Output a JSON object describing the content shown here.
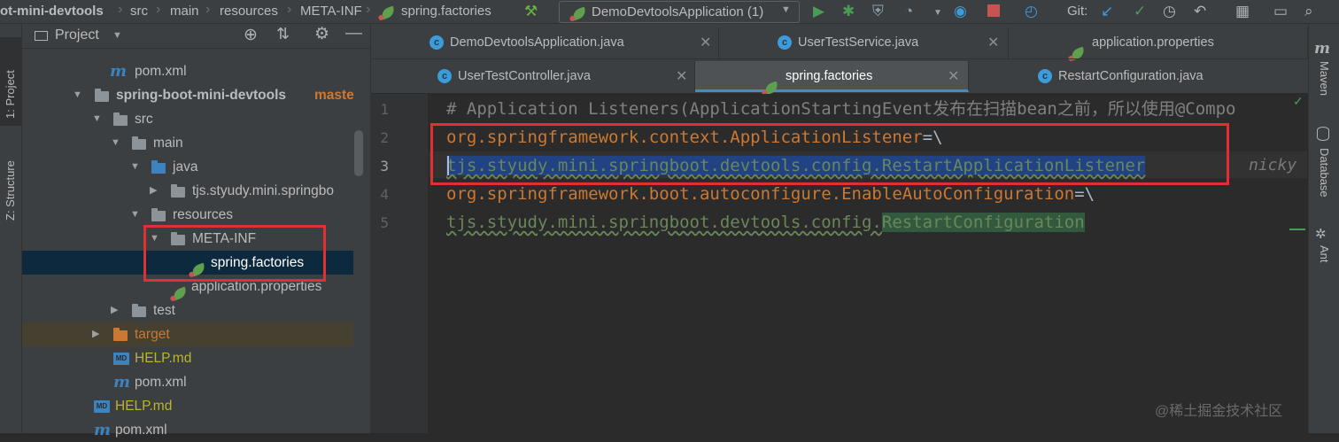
{
  "navbar": {
    "crumbs": [
      "ot-mini-devtools",
      "src",
      "main",
      "resources",
      "META-INF",
      "spring.factories"
    ],
    "run_config": "DemoDevtoolsApplication (1)",
    "git_label": "Git:"
  },
  "side_left": {
    "project_tab": "1: Project",
    "structure_tab": "Z: Structure"
  },
  "project_panel": {
    "title": "Project",
    "tree": [
      {
        "label": "pom.xml",
        "icon": "maven"
      },
      {
        "label": "spring-boot-mini-devtools",
        "icon": "folder"
      },
      {
        "label": "maste",
        "icon": "branch"
      },
      {
        "label": "src",
        "icon": "folder"
      },
      {
        "label": "main",
        "icon": "folder"
      },
      {
        "label": "java",
        "icon": "folder-blue"
      },
      {
        "label": "tjs.styudy.mini.springbo",
        "icon": "package"
      },
      {
        "label": "resources",
        "icon": "folder-resources"
      },
      {
        "label": "META-INF",
        "icon": "folder"
      },
      {
        "label": "spring.factories",
        "icon": "spring-leaf"
      },
      {
        "label": "application.properties",
        "icon": "gear-leaf"
      },
      {
        "label": "test",
        "icon": "folder"
      },
      {
        "label": "target",
        "icon": "folder-orange"
      },
      {
        "label": "HELP.md",
        "icon": "md"
      },
      {
        "label": "pom.xml",
        "icon": "maven"
      },
      {
        "label": "HELP.md",
        "icon": "md"
      },
      {
        "label": "pom.xml",
        "icon": "maven"
      }
    ]
  },
  "editor_tabs": {
    "row1": [
      "DemoDevtoolsApplication.java",
      "UserTestService.java",
      "application.properties"
    ],
    "row2": [
      "UserTestController.java",
      "spring.factories",
      "RestartConfiguration.java"
    ]
  },
  "editor": {
    "line_numbers": [
      "1",
      "2",
      "3",
      "4",
      "5"
    ],
    "line1": "# Application Listeners(ApplicationStartingEvent发布在扫描bean之前，所以使用@Compo",
    "line2_key": "org.springframework.context.ApplicationListener",
    "line2_eq": "=\\",
    "line3": "tjs.styudy.mini.springboot.devtools.config.RestartApplicationListener",
    "line3_author": "nicky",
    "line4_key": "org.springframework.boot.autoconfigure.EnableAutoConfiguration",
    "line4_eq": "=\\",
    "line5_pkg": "tjs.styudy.mini.springboot.devtools.config.",
    "line5_cls": "RestartConfiguration"
  },
  "side_right": {
    "maven": "Maven",
    "database": "Database",
    "ant": "Ant"
  },
  "watermark": "@稀土掘金技术社区"
}
